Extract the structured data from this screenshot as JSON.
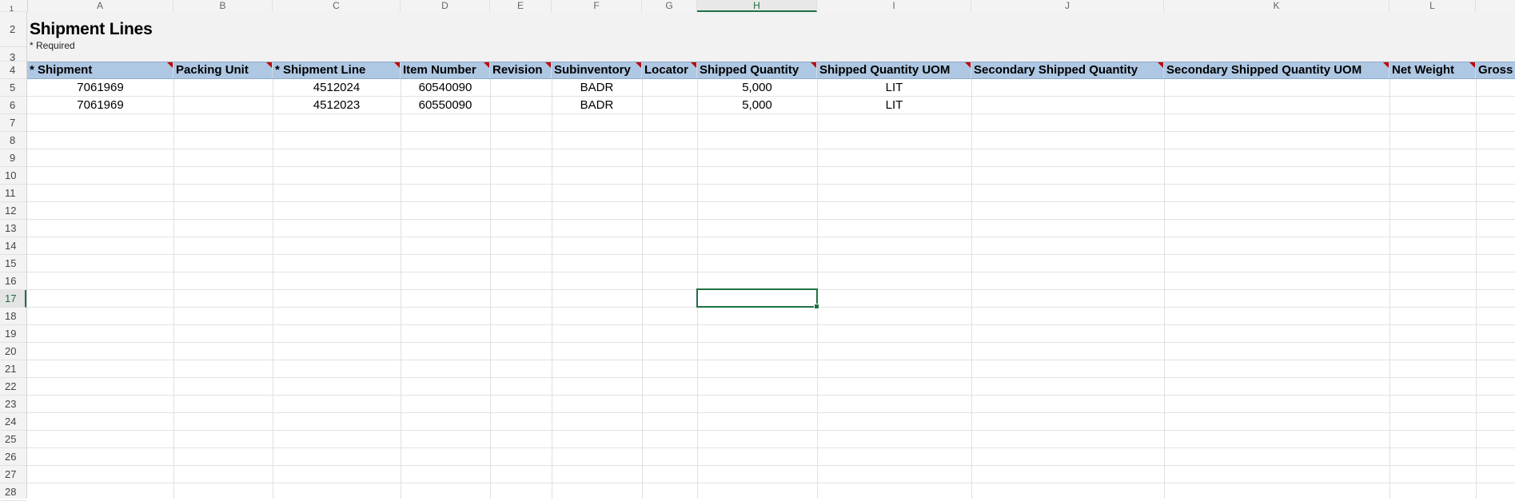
{
  "columns": [
    "A",
    "B",
    "C",
    "D",
    "E",
    "F",
    "G",
    "H",
    "I",
    "J",
    "K",
    "L"
  ],
  "active_column": "H",
  "rows": [
    "1",
    "2",
    "3",
    "4",
    "5",
    "6",
    "7",
    "8",
    "9",
    "10",
    "11",
    "12",
    "13",
    "14",
    "15",
    "16",
    "17",
    "18",
    "19",
    "20",
    "21",
    "22",
    "23",
    "24",
    "25",
    "26",
    "27",
    "28"
  ],
  "active_row": "17",
  "sheet": {
    "title": "Shipment Lines",
    "required_note": "* Required",
    "headers": [
      "* Shipment",
      "Packing Unit",
      "* Shipment Line",
      "Item Number",
      "Revision",
      "Subinventory",
      "Locator",
      "Shipped Quantity",
      "Shipped Quantity UOM",
      "Secondary Shipped Quantity",
      "Secondary Shipped Quantity UOM",
      "Net Weight",
      "Gross"
    ],
    "data_rows": [
      {
        "shipment": "7061969",
        "packing_unit": "",
        "shipment_line": "4512024",
        "item_number": "60540090",
        "revision": "",
        "subinventory": "BADR",
        "locator": "",
        "shipped_quantity": "5,000",
        "shipped_quantity_uom": "LIT"
      },
      {
        "shipment": "7061969",
        "packing_unit": "",
        "shipment_line": "4512023",
        "item_number": "60550090",
        "revision": "",
        "subinventory": "BADR",
        "locator": "",
        "shipped_quantity": "5,000",
        "shipped_quantity_uom": "LIT"
      }
    ]
  },
  "colors": {
    "header_fill": "#aec7e2",
    "required_marker": "#c00000",
    "selection": "#1e7145"
  }
}
